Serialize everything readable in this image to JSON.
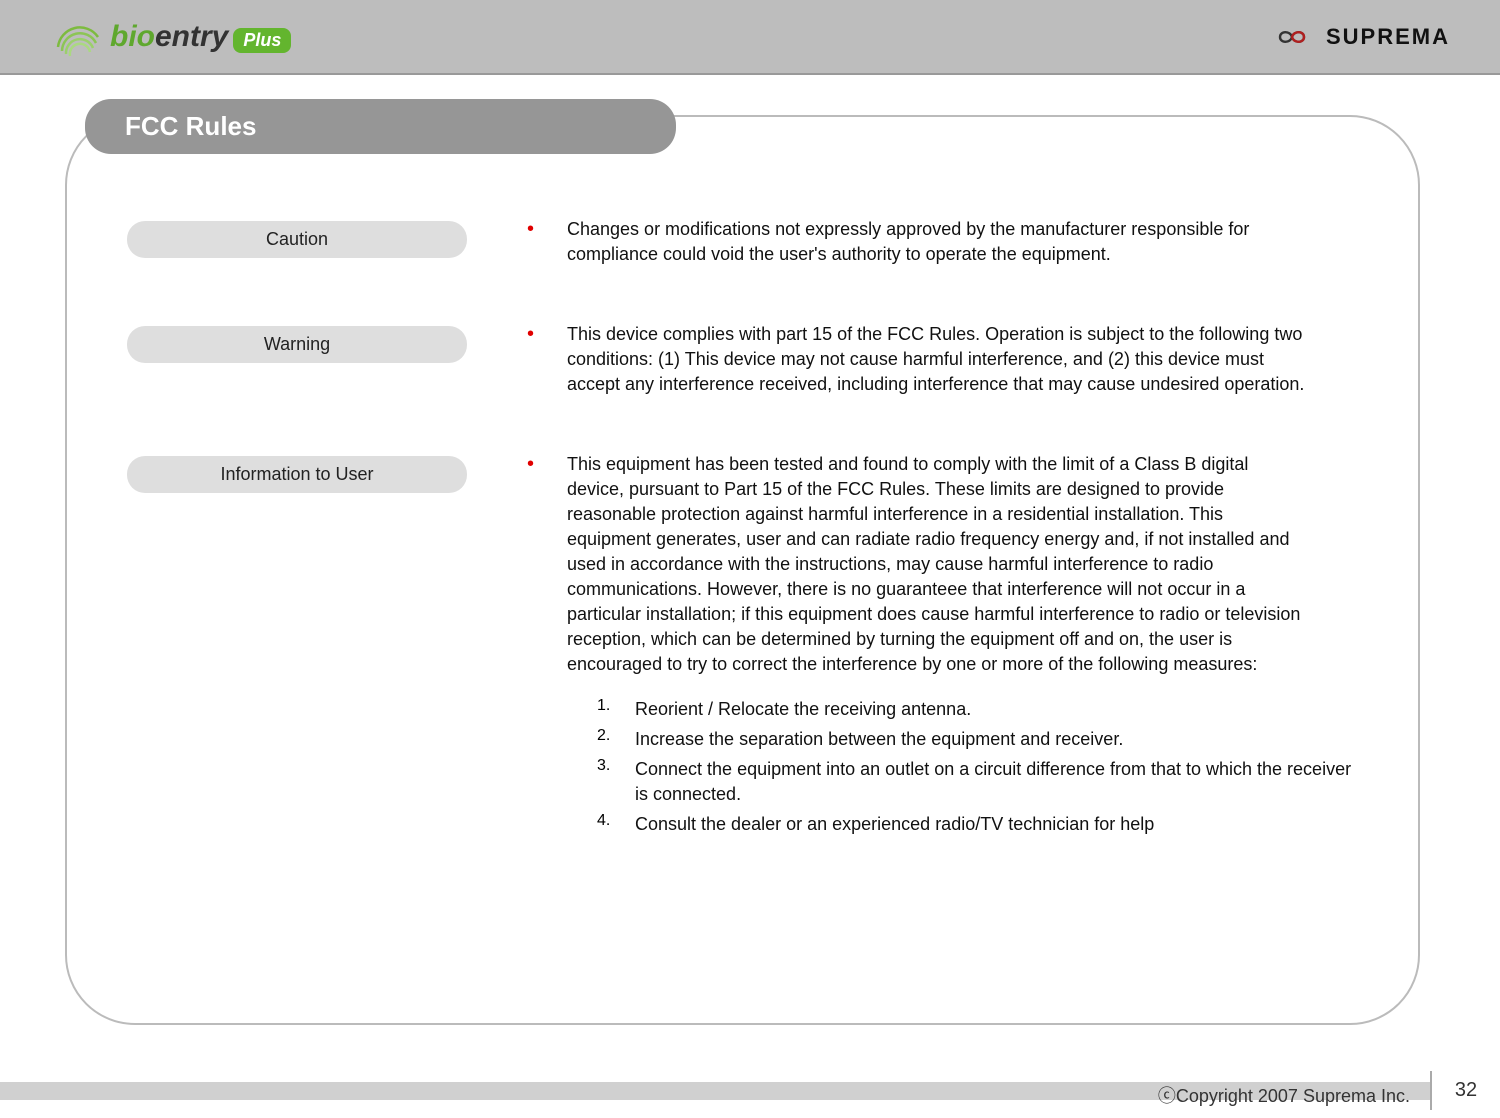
{
  "header": {
    "logo_bio": "bio",
    "logo_entry": "entry",
    "logo_plus": "Plus",
    "suprema": "SUPREMA"
  },
  "title": "FCC Rules",
  "sections": [
    {
      "label": "Caution",
      "text": "Changes or modifications not expressly approved by the manufacturer responsible for compliance could void the user's authority to operate the equipment."
    },
    {
      "label": "Warning",
      "text": "This device complies with part 15 of the FCC Rules. Operation is subject to the following two conditions: (1) This device may not cause harmful interference, and (2) this device must accept any interference received, including interference that may cause undesired operation."
    },
    {
      "label": "Information to User",
      "text": "This equipment has been tested and found to comply with the limit of a Class B digital device, pursuant to Part 15 of the FCC Rules. These limits are designed to provide reasonable protection against harmful interference in a residential installation. This equipment generates, user and can radiate radio frequency energy and, if not installed and used in accordance with the instructions, may cause harmful interference to radio communications. However, there is no guaranteee that interference will not occur in a particular installation; if this equipment does cause harmful interference to radio or television reception, which can be determined by turning the equipment off and on, the user is encouraged to try to correct the interference by one or more of the following measures:"
    }
  ],
  "numbered": [
    "Reorient / Relocate the receiving antenna.",
    "Increase the separation between the equipment and receiver.",
    "Connect the equipment into an outlet on a circuit difference from that to which the receiver is connected.",
    "Consult the dealer or an experienced radio/TV technician for help"
  ],
  "footer": {
    "page": "32",
    "copyright": "ⓒCopyright 2007 Suprema Inc."
  }
}
